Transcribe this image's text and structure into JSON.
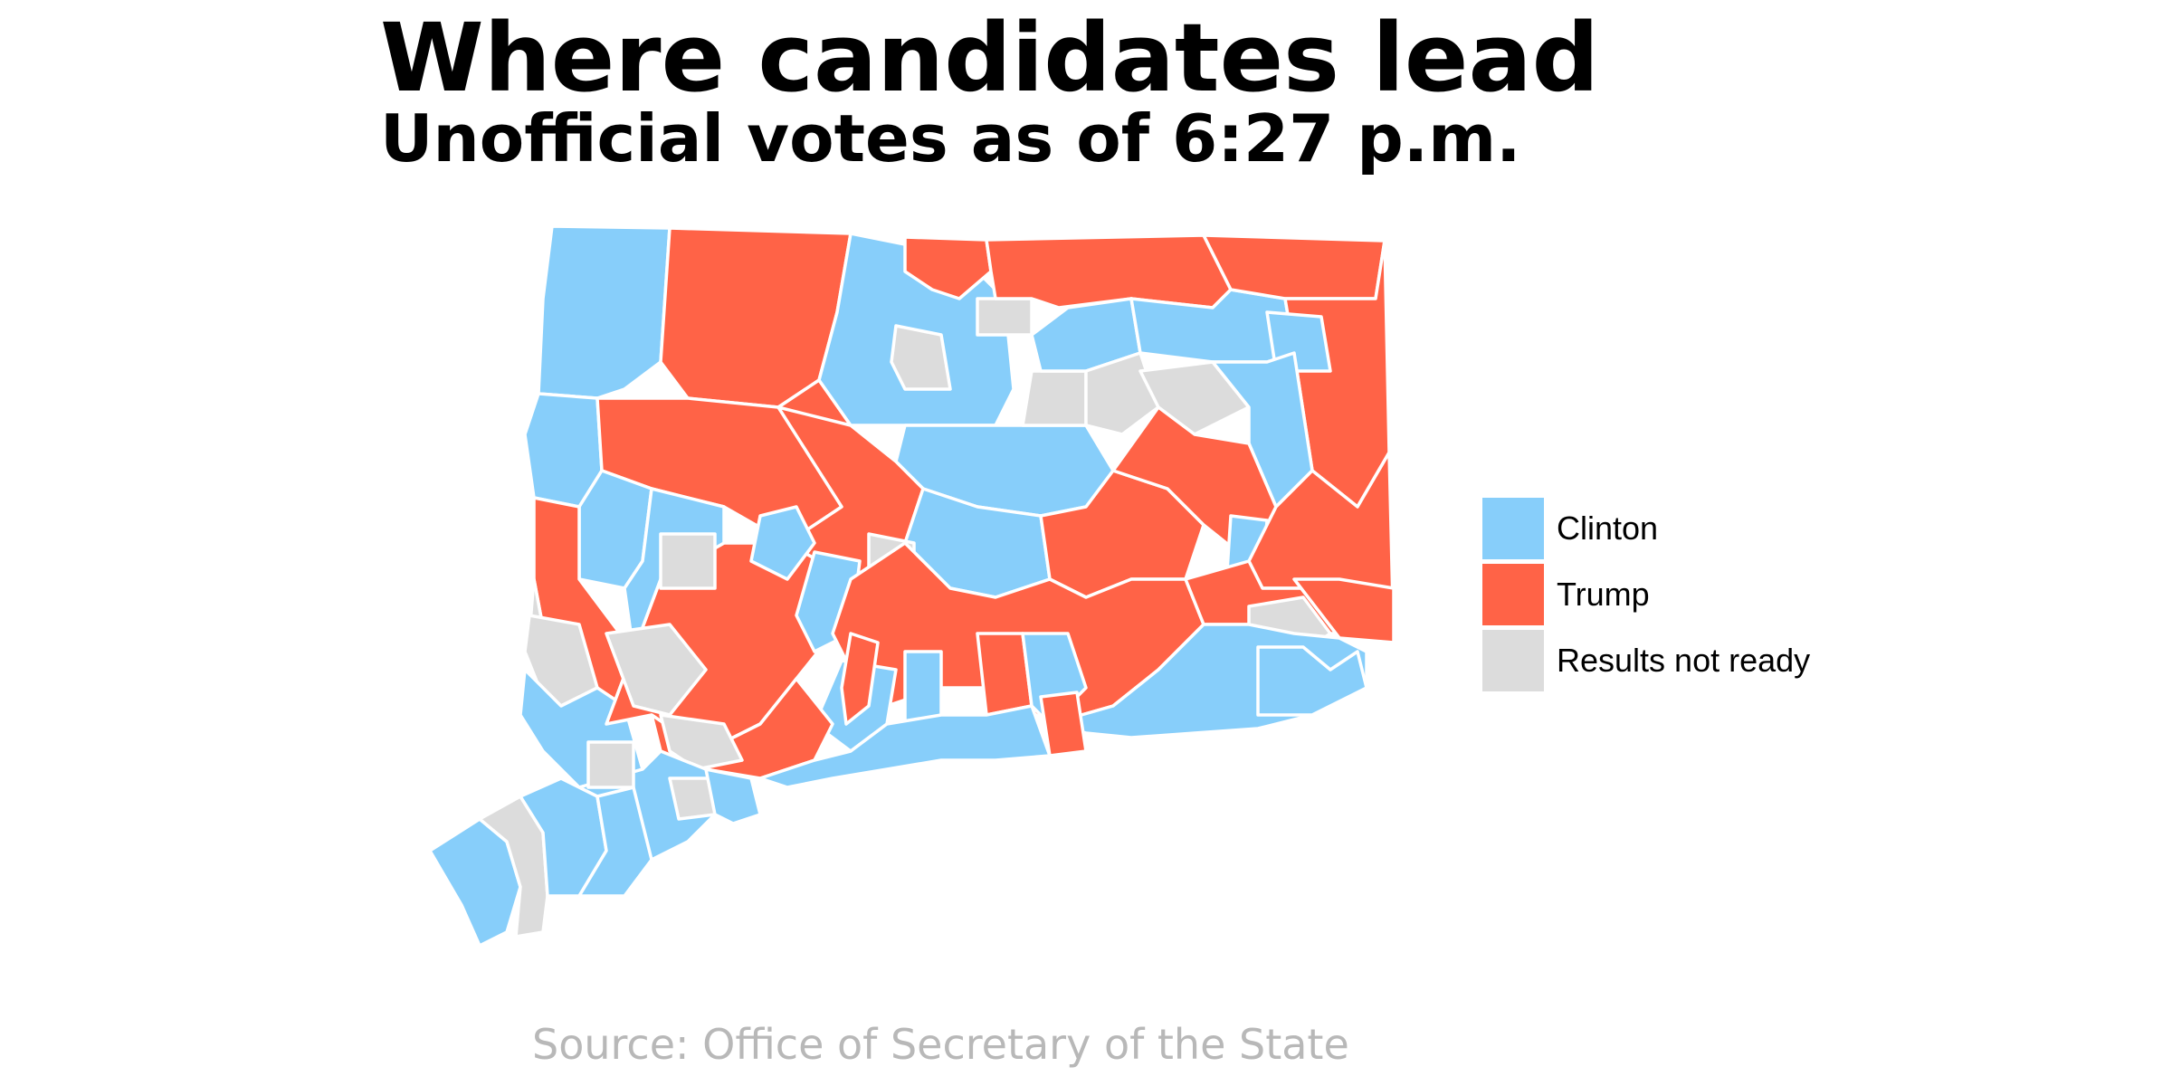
{
  "title": "Where candidates lead",
  "subtitle": "Unofficial votes as of 6:27 p.m.",
  "source": "Source: Office of Secretary of the State",
  "colors": {
    "clinton": "#87cefa",
    "trump": "#ff6347",
    "not_ready": "#dcdcdc",
    "border": "#ffffff"
  },
  "legend": [
    {
      "label": "Clinton",
      "key": "clinton"
    },
    {
      "label": "Trump",
      "key": "trump"
    },
    {
      "label": "Results not ready",
      "key": "not_ready"
    }
  ]
}
